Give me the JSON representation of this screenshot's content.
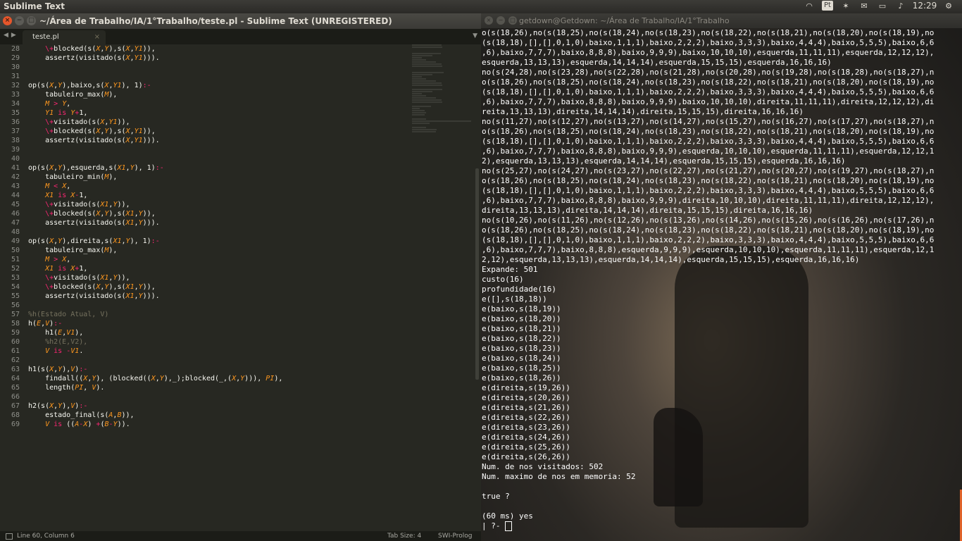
{
  "panel": {
    "app_name": "Sublime Text",
    "indicators": {
      "wifi": "wifi-icon",
      "keyboard_layout": "Pt",
      "bluetooth": "bluetooth-icon",
      "mail": "mail-icon",
      "battery": "battery-icon",
      "volume": "volume-icon",
      "time": "12:29",
      "settings": "gear-icon"
    }
  },
  "sublime": {
    "window_title": "~/Área de Trabalho/IA/1°Trabalho/teste.pl - Sublime Text (UNREGISTERED)",
    "tab": {
      "label": "teste.pl",
      "close": "×"
    },
    "line_numbers": [
      "28",
      "29",
      "30",
      "31",
      "32",
      "33",
      "34",
      "35",
      "36",
      "37",
      "38",
      "39",
      "40",
      "41",
      "42",
      "43",
      "44",
      "45",
      "46",
      "47",
      "48",
      "49",
      "50",
      "51",
      "52",
      "53",
      "54",
      "55",
      "56",
      "57",
      "58",
      "59",
      "60",
      "61",
      "62",
      "63",
      "64",
      "65",
      "66",
      "67",
      "68",
      "69"
    ],
    "code": [
      "    \\+blocked(s(X,Y),s(X,Y1)),",
      "    assertz(visitado(s(X,Y1))).",
      "",
      "",
      "op(s(X,Y),baixo,s(X,Y1), 1):-",
      "    tabuleiro_max(M),",
      "    M > Y,",
      "    Y1 is Y+1,",
      "    \\+visitado(s(X,Y1)),",
      "    \\+blocked(s(X,Y),s(X,Y1)),",
      "    assertz(visitado(s(X,Y1))).",
      "",
      "",
      "op(s(X,Y),esquerda,s(X1,Y), 1):-",
      "    tabuleiro_min(M),",
      "    M < X,",
      "    X1 is X-1,",
      "    \\+visitado(s(X1,Y)),",
      "    \\+blocked(s(X,Y),s(X1,Y)),",
      "    assertz(visitado(s(X1,Y))).",
      "",
      "op(s(X,Y),direita,s(X1,Y), 1):-",
      "    tabuleiro_max(M),",
      "    M > X,",
      "    X1 is X+1,",
      "    \\+visitado(s(X1,Y)),",
      "    \\+blocked(s(X,Y),s(X1,Y)),",
      "    assertz(visitado(s(X1,Y))).",
      "",
      "%h(Estado Atual, V)",
      "h(E,V):-",
      "    h1(E,V1),",
      "    %h2(E,V2),",
      "    V is -V1.",
      "",
      "h1(s(X,Y),V):-",
      "    findall((X,Y), (blocked((X,Y),_);blocked(_,(X,Y))), PI),",
      "    length(PI, V).",
      "",
      "h2(s(X,Y),V):-",
      "    estado_final(s(A,B)),",
      "    V is ((A-X) +(B-Y))."
    ],
    "status": {
      "position": "Line 60, Column 6",
      "tab_size": "Tab Size: 4",
      "syntax": "SWI-Prolog"
    },
    "colors": {
      "background": "#272822",
      "text": "#f8f8f2",
      "keyword": "#f92672",
      "variable": "#fd971f",
      "comment": "#75715e"
    }
  },
  "terminal": {
    "window_title": "getdown@Getdown: ~/Área de Trabalho/IA/1°Trabalho",
    "lines": [
      "o(s(18,26),no(s(18,25),no(s(18,24),no(s(18,23),no(s(18,22),no(s(18,21),no(s(18,20),no(s(18,19),no",
      "(s(18,18),[],[],0,1,0),baixo,1,1,1),baixo,2,2,2),baixo,3,3,3),baixo,4,4,4),baixo,5,5,5),baixo,6,6",
      ",6),baixo,7,7,7),baixo,8,8,8),baixo,9,9,9),baixo,10,10,10),esquerda,11,11,11),esquerda,12,12,12),",
      "esquerda,13,13,13),esquerda,14,14,14),esquerda,15,15,15),esquerda,16,16,16)",
      "no(s(24,28),no(s(23,28),no(s(22,28),no(s(21,28),no(s(20,28),no(s(19,28),no(s(18,28),no(s(18,27),n",
      "o(s(18,26),no(s(18,25),no(s(18,24),no(s(18,23),no(s(18,22),no(s(18,21),no(s(18,20),no(s(18,19),no",
      "(s(18,18),[],[],0,1,0),baixo,1,1,1),baixo,2,2,2),baixo,3,3,3),baixo,4,4,4),baixo,5,5,5),baixo,6,6",
      ",6),baixo,7,7,7),baixo,8,8,8),baixo,9,9,9),baixo,10,10,10),direita,11,11,11),direita,12,12,12),di",
      "reita,13,13,13),direita,14,14,14),direita,15,15,15),direita,16,16,16)",
      "no(s(11,27),no(s(12,27),no(s(13,27),no(s(14,27),no(s(15,27),no(s(16,27),no(s(17,27),no(s(18,27),n",
      "o(s(18,26),no(s(18,25),no(s(18,24),no(s(18,23),no(s(18,22),no(s(18,21),no(s(18,20),no(s(18,19),no",
      "(s(18,18),[],[],0,1,0),baixo,1,1,1),baixo,2,2,2),baixo,3,3,3),baixo,4,4,4),baixo,5,5,5),baixo,6,6",
      ",6),baixo,7,7,7),baixo,8,8,8),baixo,9,9,9),esquerda,10,10,10),esquerda,11,11,11),esquerda,12,12,1",
      "2),esquerda,13,13,13),esquerda,14,14,14),esquerda,15,15,15),esquerda,16,16,16)",
      "no(s(25,27),no(s(24,27),no(s(23,27),no(s(22,27),no(s(21,27),no(s(20,27),no(s(19,27),no(s(18,27),n",
      "o(s(18,26),no(s(18,25),no(s(18,24),no(s(18,23),no(s(18,22),no(s(18,21),no(s(18,20),no(s(18,19),no",
      "(s(18,18),[],[],0,1,0),baixo,1,1,1),baixo,2,2,2),baixo,3,3,3),baixo,4,4,4),baixo,5,5,5),baixo,6,6",
      ",6),baixo,7,7,7),baixo,8,8,8),baixo,9,9,9),direita,10,10,10),direita,11,11,11),direita,12,12,12),",
      "direita,13,13,13),direita,14,14,14),direita,15,15,15),direita,16,16,16)",
      "no(s(10,26),no(s(11,26),no(s(12,26),no(s(13,26),no(s(14,26),no(s(15,26),no(s(16,26),no(s(17,26),n",
      "o(s(18,26),no(s(18,25),no(s(18,24),no(s(18,23),no(s(18,22),no(s(18,21),no(s(18,20),no(s(18,19),no",
      "(s(18,18),[],[],0,1,0),baixo,1,1,1),baixo,2,2,2),baixo,3,3,3),baixo,4,4,4),baixo,5,5,5),baixo,6,6",
      ",6),baixo,7,7,7),baixo,8,8,8),esquerda,9,9,9),esquerda,10,10,10),esquerda,11,11,11),esquerda,12,1",
      "2,12),esquerda,13,13,13),esquerda,14,14,14),esquerda,15,15,15),esquerda,16,16,16)",
      "Expande: 501",
      "custo(16)",
      "profundidade(16)",
      "e([],s(18,18))",
      "e(baixo,s(18,19))",
      "e(baixo,s(18,20))",
      "e(baixo,s(18,21))",
      "e(baixo,s(18,22))",
      "e(baixo,s(18,23))",
      "e(baixo,s(18,24))",
      "e(baixo,s(18,25))",
      "e(baixo,s(18,26))",
      "e(direita,s(19,26))",
      "e(direita,s(20,26))",
      "e(direita,s(21,26))",
      "e(direita,s(22,26))",
      "e(direita,s(23,26))",
      "e(direita,s(24,26))",
      "e(direita,s(25,26))",
      "e(direita,s(26,26))",
      "Num. de nos visitados: 502",
      "Num. maximo de nos em memoria: 52",
      "",
      "true ?",
      "",
      "(60 ms) yes"
    ],
    "prompt": "| ?- "
  }
}
